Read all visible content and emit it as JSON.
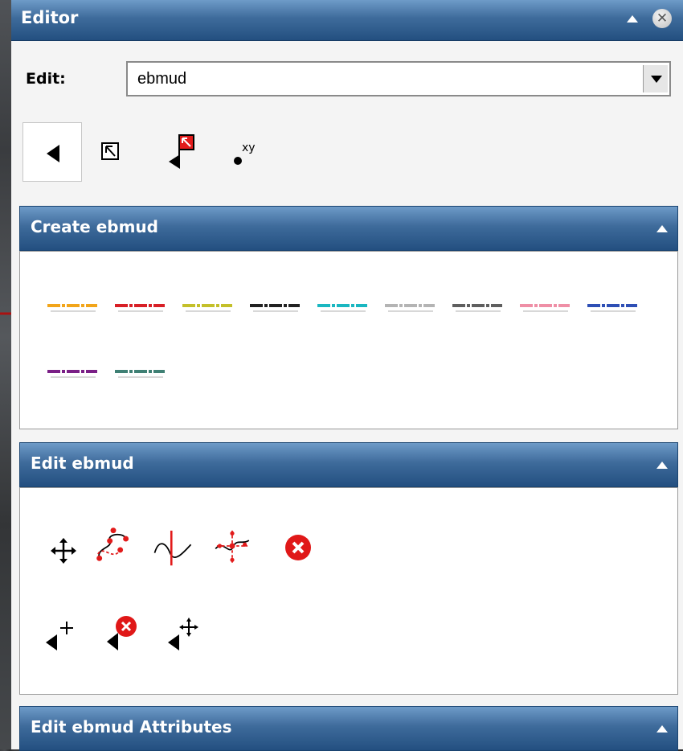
{
  "window": {
    "title": "Editor"
  },
  "edit": {
    "label": "Edit:",
    "layer_value": "ebmud"
  },
  "tools": [
    {
      "name": "select-tool-icon"
    },
    {
      "name": "select-by-rectangle-icon"
    },
    {
      "name": "identify-flag-icon"
    },
    {
      "name": "xy-point-icon"
    }
  ],
  "create_section": {
    "title": "Create ebmud",
    "templates": [
      {
        "color": "#f2a51a"
      },
      {
        "color": "#d81f26"
      },
      {
        "color": "#c4c02a"
      },
      {
        "color": "#222222"
      },
      {
        "color": "#1ab7c1"
      },
      {
        "color": "#b4b4b4"
      },
      {
        "color": "#5f5f5f"
      },
      {
        "color": "#ef8fa6"
      },
      {
        "color": "#2e4fb5"
      },
      {
        "color": "#7a1f86"
      },
      {
        "color": "#3f8074"
      }
    ]
  },
  "edit_section": {
    "title": "Edit ebmud",
    "tools_row1": [
      "move-icon",
      "reshape-vertices-icon",
      "split-line-icon",
      "add-vertex-icon",
      "delete-icon"
    ],
    "tools_row2": [
      "add-point-cursor-icon",
      "delete-point-cursor-icon",
      "move-point-cursor-icon"
    ]
  },
  "attributes_section": {
    "title": "Edit ebmud Attributes"
  },
  "colors": {
    "header_top": "#6e9bc8",
    "header_bottom": "#234f80",
    "accent_red": "#d81f26"
  }
}
